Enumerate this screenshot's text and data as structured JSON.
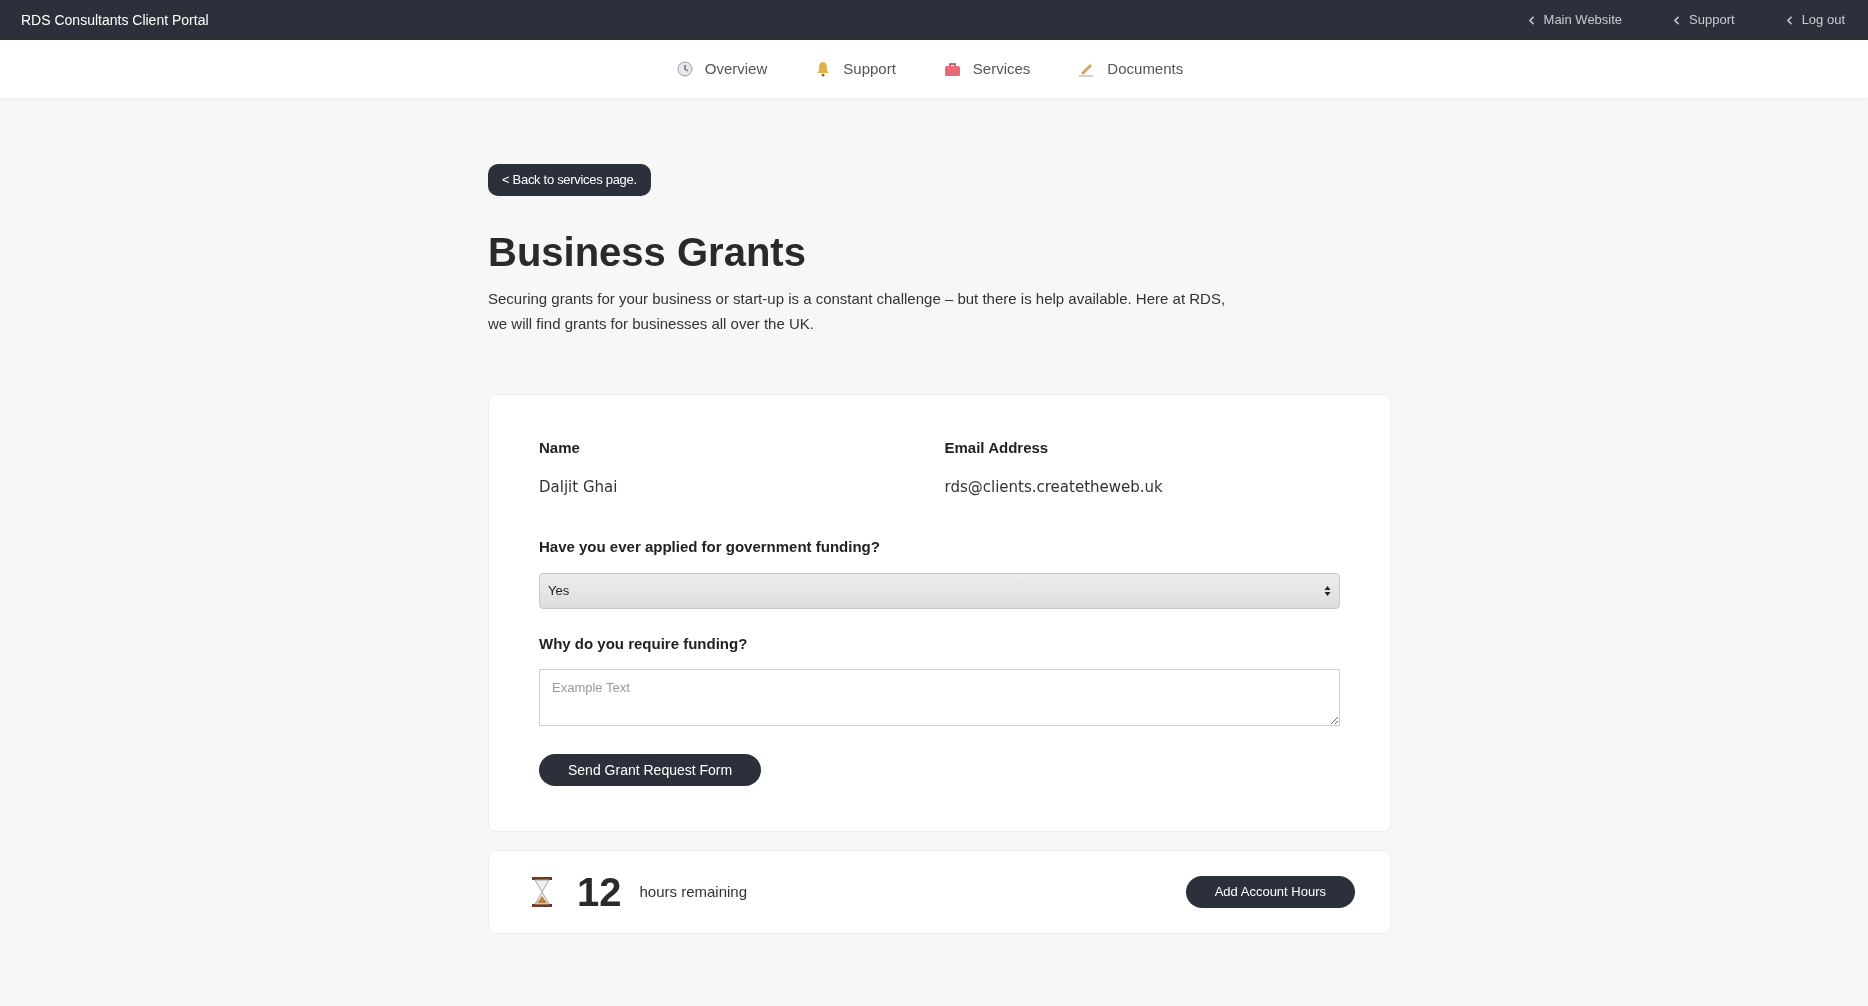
{
  "top_bar": {
    "title": "RDS Consultants Client Portal",
    "links": [
      {
        "label": "Main Website"
      },
      {
        "label": "Support"
      },
      {
        "label": "Log out"
      }
    ]
  },
  "nav": [
    {
      "label": "Overview",
      "kind": "clock"
    },
    {
      "label": "Support",
      "kind": "bell"
    },
    {
      "label": "Services",
      "kind": "briefcase"
    },
    {
      "label": "Documents",
      "kind": "pen"
    }
  ],
  "back_button": "< Back to services page.",
  "heading": "Business Grants",
  "intro": "Securing grants for your business or start-up is a constant challenge – but there is help available. Here at RDS, we will find grants for businesses all over the UK.",
  "form": {
    "fields": [
      {
        "label": "Name",
        "value": "Daljit Ghai"
      },
      {
        "label": "Email Address",
        "value": "rds@clients.createtheweb.uk"
      }
    ],
    "select": {
      "label": "Have you ever applied for government funding?",
      "value": "Yes"
    },
    "textarea": {
      "label": "Why do you require funding?",
      "placeholder": "Example Text"
    },
    "submit": "Send Grant Request Form"
  },
  "hours": {
    "count": "12",
    "label": "hours remaining",
    "button": "Add Account Hours"
  }
}
